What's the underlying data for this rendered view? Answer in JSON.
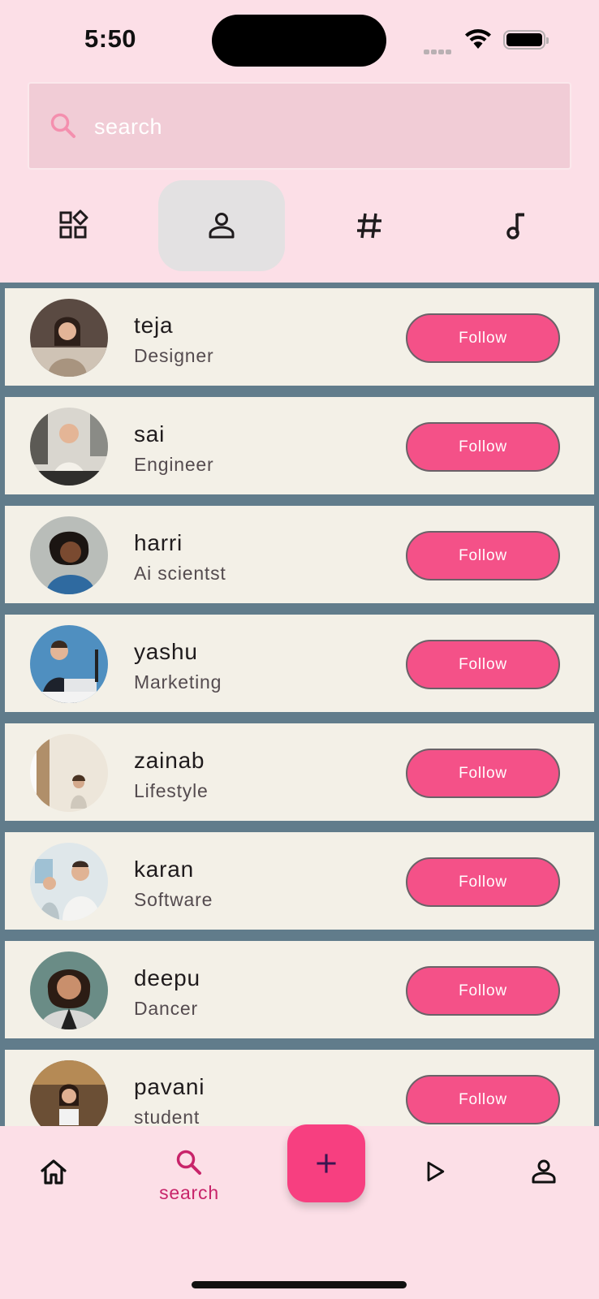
{
  "status_bar": {
    "time": "5:50"
  },
  "search": {
    "placeholder": "search"
  },
  "tabs": [
    {
      "icon": "widgets-icon",
      "active": false
    },
    {
      "icon": "person-icon",
      "active": true
    },
    {
      "icon": "hashtag-icon",
      "active": false
    },
    {
      "icon": "music-note-icon",
      "active": false
    }
  ],
  "users": [
    {
      "name": "teja",
      "role": "Designer",
      "follow_label": "Follow"
    },
    {
      "name": "sai",
      "role": "Engineer",
      "follow_label": "Follow"
    },
    {
      "name": "harri",
      "role": "Ai scientst",
      "follow_label": "Follow"
    },
    {
      "name": "yashu",
      "role": "Marketing",
      "follow_label": "Follow"
    },
    {
      "name": "zainab",
      "role": "Lifestyle",
      "follow_label": "Follow"
    },
    {
      "name": "karan",
      "role": "Software",
      "follow_label": "Follow"
    },
    {
      "name": "deepu",
      "role": "Dancer",
      "follow_label": "Follow"
    },
    {
      "name": "pavani",
      "role": "student",
      "follow_label": "Follow"
    }
  ],
  "bottom_nav": {
    "search_label": "search",
    "active": "search"
  },
  "colors": {
    "background": "#fcdfe7",
    "accent": "#f45188",
    "fab": "#f73f80",
    "list_background": "#617c8b",
    "card": "#f3f0e7"
  }
}
